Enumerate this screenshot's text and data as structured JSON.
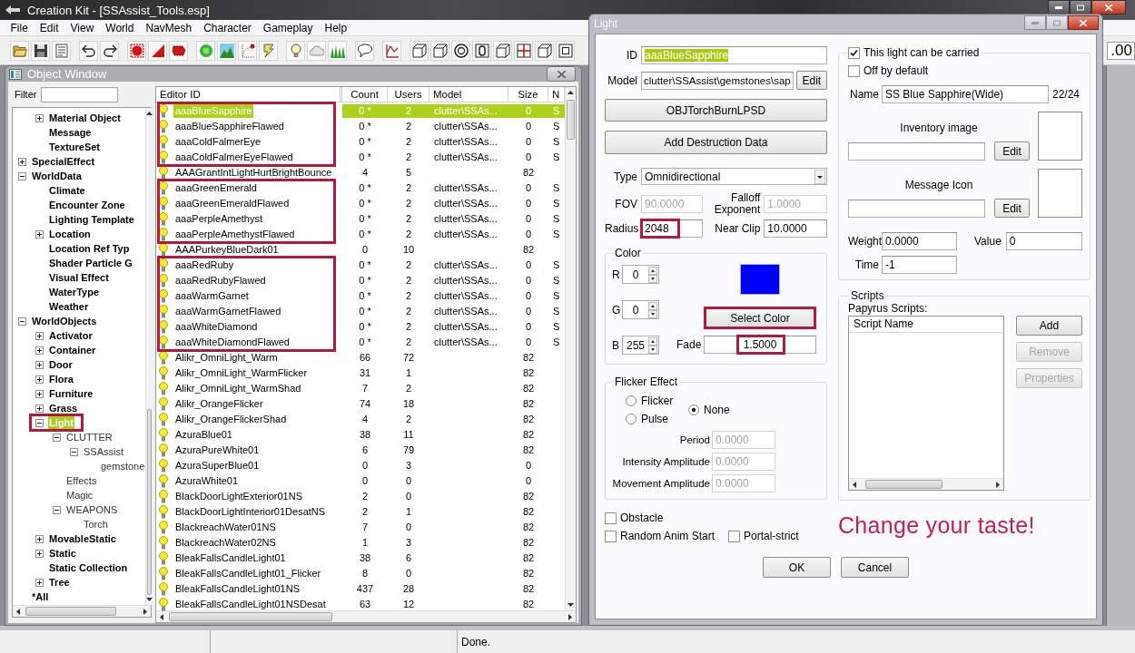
{
  "main_window": {
    "title": "Creation Kit - [SSAssist_Tools.esp]",
    "menu": [
      "File",
      "Edit",
      "View",
      "World",
      "NavMesh",
      "Character",
      "Gameplay",
      "Help"
    ],
    "toolbar_value": ".00"
  },
  "object_window": {
    "title": "Object Window",
    "filter_label": "Filter",
    "tree": {
      "partial_branch": [
        {
          "label": "Material Object",
          "expanded": false,
          "selected": false,
          "framed": false
        },
        {
          "label": "Message",
          "selected": false,
          "framed": false
        },
        {
          "label": "TextureSet",
          "selected": false,
          "framed": false
        }
      ],
      "items": [
        {
          "label": "SpecialEffect",
          "expanded": false,
          "selected": false,
          "framed": false
        },
        {
          "label": "WorldData",
          "expanded": true,
          "selected": false,
          "framed": false,
          "children": [
            {
              "label": "Climate",
              "selected": false,
              "framed": false
            },
            {
              "label": "Encounter Zone",
              "selected": false,
              "framed": false
            },
            {
              "label": "Lighting Template",
              "selected": false,
              "framed": false
            },
            {
              "label": "Location",
              "expanded": false,
              "selected": false,
              "framed": false
            },
            {
              "label": "Location Ref Typ",
              "selected": false,
              "framed": false
            },
            {
              "label": "Shader Particle G",
              "selected": false,
              "framed": false
            },
            {
              "label": "Visual Effect",
              "selected": false,
              "framed": false
            },
            {
              "label": "WaterType",
              "selected": false,
              "framed": false
            },
            {
              "label": "Weather",
              "selected": false,
              "framed": false
            }
          ]
        },
        {
          "label": "WorldObjects",
          "expanded": true,
          "selected": false,
          "framed": false,
          "children": [
            {
              "label": "Activator",
              "expanded": false,
              "selected": false,
              "framed": false
            },
            {
              "label": "Container",
              "expanded": false,
              "selected": false,
              "framed": false
            },
            {
              "label": "Door",
              "expanded": false,
              "selected": false,
              "framed": false
            },
            {
              "label": "Flora",
              "expanded": false,
              "selected": false,
              "framed": false
            },
            {
              "label": "Furniture",
              "expanded": false,
              "selected": false,
              "framed": false
            },
            {
              "label": "Grass",
              "expanded": false,
              "selected": false,
              "framed": false
            },
            {
              "label": "Light",
              "expanded": true,
              "selected": true,
              "framed": true,
              "children": [
                {
                  "label": "CLUTTER",
                  "expanded": true,
                  "selected": false,
                  "framed": false,
                  "children": [
                    {
                      "label": "SSAssist",
                      "expanded": true,
                      "selected": false,
                      "framed": false,
                      "children": [
                        {
                          "label": "gemstone",
                          "selected": false,
                          "framed": false
                        }
                      ]
                    }
                  ]
                },
                {
                  "label": "Effects",
                  "selected": false,
                  "framed": false
                },
                {
                  "label": "Magic",
                  "selected": false,
                  "framed": false
                },
                {
                  "label": "WEAPONS",
                  "expanded": true,
                  "selected": false,
                  "framed": false,
                  "children": [
                    {
                      "label": "Torch",
                      "selected": false,
                      "framed": false
                    }
                  ]
                }
              ]
            },
            {
              "label": "MovableStatic",
              "expanded": false,
              "selected": false,
              "framed": false
            },
            {
              "label": "Static",
              "expanded": false,
              "selected": false,
              "framed": false
            },
            {
              "label": "Static Collection",
              "selected": false,
              "framed": false
            },
            {
              "label": "Tree",
              "expanded": false,
              "selected": false,
              "framed": false
            }
          ]
        },
        {
          "label": "*All",
          "selected": false,
          "framed": false
        }
      ]
    },
    "list": {
      "columns": [
        "Editor ID",
        "Count",
        "Users",
        "Model",
        "Size",
        "N"
      ],
      "rows": [
        {
          "editor_id": "aaaBlueSapphire",
          "count": "0 *",
          "users": "2",
          "model": "clutter\\SSAs...",
          "size": "0",
          "column_6": "S",
          "selected": true,
          "framed": true
        },
        {
          "editor_id": "aaaBlueSapphireFlawed",
          "count": "0 *",
          "users": "2",
          "model": "clutter\\SSAs...",
          "size": "0",
          "column_6": "S",
          "selected": false,
          "framed": true
        },
        {
          "editor_id": "aaaColdFalmerEye",
          "count": "0 *",
          "users": "2",
          "model": "clutter\\SSAs...",
          "size": "0",
          "column_6": "S",
          "selected": false,
          "framed": true
        },
        {
          "editor_id": "aaaColdFalmerEyeFlawed",
          "count": "0 *",
          "users": "2",
          "model": "clutter\\SSAs...",
          "size": "0",
          "column_6": "S",
          "selected": false,
          "framed": true
        },
        {
          "editor_id": "AAAGrantIntLightHurtBrightBounce",
          "count": "4",
          "users": "5",
          "size": "82",
          "selected": false,
          "framed": false
        },
        {
          "editor_id": "aaaGreenEmerald",
          "count": "0 *",
          "users": "2",
          "model": "clutter\\SSAs...",
          "size": "0",
          "column_6": "S",
          "selected": false,
          "framed": true
        },
        {
          "editor_id": "aaaGreenEmeraldFlawed",
          "count": "0 *",
          "users": "2",
          "model": "clutter\\SSAs...",
          "size": "0",
          "column_6": "S",
          "selected": false,
          "framed": true
        },
        {
          "editor_id": "aaaPerpleAmethyst",
          "count": "0 *",
          "users": "2",
          "model": "clutter\\SSAs...",
          "size": "0",
          "column_6": "S",
          "selected": false,
          "framed": true
        },
        {
          "editor_id": "aaaPerpleAmethystFlawed",
          "count": "0 *",
          "users": "2",
          "model": "clutter\\SSAs...",
          "size": "0",
          "column_6": "S",
          "selected": false,
          "framed": true
        },
        {
          "editor_id": "AAAPurkeyBlueDark01",
          "count": "0",
          "users": "10",
          "size": "82",
          "selected": false,
          "framed": false
        },
        {
          "editor_id": "aaaRedRuby",
          "count": "0 *",
          "users": "2",
          "model": "clutter\\SSAs...",
          "size": "0",
          "column_6": "S",
          "selected": false,
          "framed": true
        },
        {
          "editor_id": "aaaRedRubyFlawed",
          "count": "0 *",
          "users": "2",
          "model": "clutter\\SSAs...",
          "size": "0",
          "column_6": "S",
          "selected": false,
          "framed": true
        },
        {
          "editor_id": "aaaWarmGarnet",
          "count": "0 *",
          "users": "2",
          "model": "clutter\\SSAs...",
          "size": "0",
          "column_6": "S",
          "selected": false,
          "framed": true
        },
        {
          "editor_id": "aaaWarmGarnetFlawed",
          "count": "0 *",
          "users": "2",
          "model": "clutter\\SSAs...",
          "size": "0",
          "column_6": "S",
          "selected": false,
          "framed": true
        },
        {
          "editor_id": "aaaWhiteDiamond",
          "count": "0 *",
          "users": "2",
          "model": "clutter\\SSAs...",
          "size": "0",
          "column_6": "S",
          "selected": false,
          "framed": true
        },
        {
          "editor_id": "aaaWhiteDiamondFlawed",
          "count": "0 *",
          "users": "2",
          "model": "clutter\\SSAs...",
          "size": "0",
          "column_6": "S",
          "selected": false,
          "framed": true
        },
        {
          "editor_id": "Alikr_OmniLight_Warm",
          "count": "66",
          "users": "72",
          "size": "82",
          "selected": false,
          "framed": false
        },
        {
          "editor_id": "Alikr_OmniLight_WarmFlicker",
          "count": "31",
          "users": "1",
          "size": "82",
          "selected": false,
          "framed": false
        },
        {
          "editor_id": "Alikr_OmniLight_WarmShad",
          "count": "7",
          "users": "2",
          "size": "82",
          "selected": false,
          "framed": false
        },
        {
          "editor_id": "Alikr_OrangeFlicker",
          "count": "74",
          "users": "18",
          "size": "82",
          "selected": false,
          "framed": false
        },
        {
          "editor_id": "Alikr_OrangeFlickerShad",
          "count": "4",
          "users": "2",
          "size": "82",
          "selected": false,
          "framed": false
        },
        {
          "editor_id": "AzuraBlue01",
          "count": "38",
          "users": "11",
          "size": "82",
          "selected": false,
          "framed": false
        },
        {
          "editor_id": "AzuraPureWhite01",
          "count": "6",
          "users": "79",
          "size": "82",
          "selected": false,
          "framed": false
        },
        {
          "editor_id": "AzuraSuperBlue01",
          "count": "0",
          "users": "3",
          "size": "0",
          "selected": false,
          "framed": false
        },
        {
          "editor_id": "AzuraWhite01",
          "count": "0",
          "users": "0",
          "size": "0",
          "selected": false,
          "framed": false
        },
        {
          "editor_id": "BlackDoorLightExterior01NS",
          "count": "2",
          "users": "0",
          "size": "82",
          "selected": false,
          "framed": false
        },
        {
          "editor_id": "BlackDoorLightInterior01DesatNS",
          "count": "2",
          "users": "1",
          "size": "82",
          "selected": false,
          "framed": false
        },
        {
          "editor_id": "BlackreachWater01NS",
          "count": "7",
          "users": "0",
          "size": "82",
          "selected": false,
          "framed": false
        },
        {
          "editor_id": "BlackreachWater02NS",
          "count": "1",
          "users": "3",
          "size": "82",
          "selected": false,
          "framed": false
        },
        {
          "editor_id": "BleakFallsCandleLight01",
          "count": "38",
          "users": "6",
          "size": "82",
          "selected": false,
          "framed": false
        },
        {
          "editor_id": "BleakFallsCandleLight01_Flicker",
          "count": "8",
          "users": "0",
          "size": "82",
          "selected": false,
          "framed": false
        },
        {
          "editor_id": "BleakFallsCandleLight01NS",
          "count": "437",
          "users": "28",
          "size": "82",
          "selected": false,
          "framed": false
        },
        {
          "editor_id": "BleakFallsCandleLight01NSDesat",
          "count": "63",
          "users": "12",
          "size": "82",
          "selected": false,
          "framed": false
        }
      ]
    }
  },
  "light_dialog": {
    "title": "Light",
    "id": {
      "label": "ID",
      "value": "aaaBlueSapphire",
      "text_selected": true
    },
    "model": {
      "label": "Model",
      "value": "clutter\\SSAssist\\gemstones\\sap",
      "button": "Edit"
    },
    "sound_button": "OBJTorchBurnLPSD",
    "destruction_button": "Add Destruction Data",
    "type": {
      "label": "Type",
      "value": "Omnidirectional"
    },
    "fov": {
      "label": "FOV",
      "value": "90.0000",
      "disabled": true
    },
    "falloff": {
      "label": "Falloff Exponent",
      "value": "1.0000",
      "disabled": true
    },
    "radius": {
      "label": "Radius",
      "value": "2048",
      "disabled": false,
      "framed": true
    },
    "near_clip": {
      "label": "Near Clip",
      "value": "10.0000",
      "disabled": false,
      "framed": false
    },
    "color": {
      "label": "Color",
      "channels": [
        {
          "label": "R",
          "value": "0"
        },
        {
          "label": "G",
          "value": "0"
        },
        {
          "label": "B",
          "value": "255"
        }
      ],
      "select_button": {
        "label": "Select Color",
        "framed": true
      },
      "fade": {
        "label": "Fade",
        "value": "1.5000",
        "framed": true
      }
    },
    "flicker": {
      "label": "Flicker Effect",
      "options": [
        {
          "label": "Flicker",
          "selected": false
        },
        {
          "label": "Pulse",
          "selected": false
        },
        {
          "label": "None",
          "selected": true
        }
      ],
      "fields": [
        {
          "label": "Period",
          "value": "0.0000",
          "disabled": true
        },
        {
          "label": "Intensity Amplitude",
          "value": "0.0000",
          "disabled": true
        },
        {
          "label": "Movement Amplitude",
          "value": "0.0000",
          "disabled": true
        }
      ]
    },
    "flags": [
      {
        "label": "Obstacle",
        "checked": false
      },
      {
        "label": "Random Anim Start",
        "checked": false
      },
      {
        "label": "Portal-strict",
        "checked": false
      }
    ],
    "carried": {
      "label": "This light can be carried",
      "checked": true,
      "off_by_default": {
        "label": "Off by default",
        "checked": false
      },
      "name": {
        "label": "Name",
        "value": "SS Blue Sapphire(Wide)",
        "counter": "22/24"
      },
      "images": [
        {
          "label": "Inventory image",
          "button": "Edit"
        },
        {
          "label": "Message Icon",
          "button": "Edit"
        }
      ],
      "weight": {
        "label": "Weight",
        "value": "0.0000"
      },
      "value": {
        "label": "Value",
        "value": "0"
      },
      "time": {
        "label": "Time",
        "value": "-1"
      }
    },
    "scripts": {
      "label": "Scripts",
      "list_label": "Papyrus Scripts:",
      "column": "Script Name",
      "buttons": [
        {
          "label": "Add",
          "disabled": false
        },
        {
          "label": "Remove",
          "disabled": true
        },
        {
          "label": "Properties",
          "disabled": true
        }
      ]
    },
    "annotation": "Change your taste!",
    "buttons": [
      "OK",
      "Cancel"
    ]
  },
  "status_bar": {
    "text": "Done."
  }
}
